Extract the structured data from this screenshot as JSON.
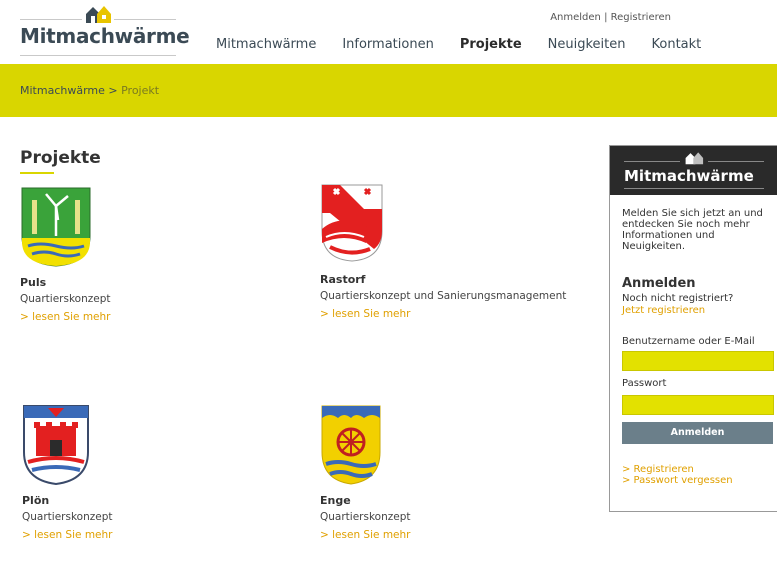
{
  "header": {
    "logo_text": "Mitmachwärme",
    "auth": {
      "login": "Anmelden",
      "separator": "|",
      "register": "Registrieren"
    },
    "nav": [
      {
        "label": "Mitmachwärme",
        "active": false
      },
      {
        "label": "Informationen",
        "active": false
      },
      {
        "label": "Projekte",
        "active": true
      },
      {
        "label": "Neuigkeiten",
        "active": false
      },
      {
        "label": "Kontakt",
        "active": false
      }
    ]
  },
  "breadcrumb": {
    "root": "Mitmachwärme",
    "separator": ">",
    "current": "Projekt"
  },
  "main": {
    "title": "Projekte",
    "projects": [
      {
        "name": "Puls",
        "type": "Quartierskonzept",
        "more": "> lesen Sie mehr",
        "crest": "puls-crest-icon"
      },
      {
        "name": "Rastorf",
        "type": "Quartierskonzept und Sanierungsmanagement",
        "more": "> lesen Sie mehr",
        "crest": "rastorf-crest-icon"
      },
      {
        "name": "Plön",
        "type": "Quartierskonzept",
        "more": "> lesen Sie mehr",
        "crest": "ploen-crest-icon"
      },
      {
        "name": "Enge",
        "type": "Quartierskonzept",
        "more": "> lesen Sie mehr",
        "crest": "enge-crest-icon"
      }
    ]
  },
  "sidebar": {
    "logo_text": "Mitmachwärme",
    "intro": "Melden Sie sich jetzt an und entdecken Sie noch mehr Informationen und Neuigkeiten.",
    "heading": "Anmelden",
    "not_registered": "Noch nicht registriert?",
    "register_now": "Jetzt registrieren",
    "username_label": "Benutzername oder E-Mail",
    "username_value": "",
    "password_label": "Passwort",
    "password_value": "",
    "submit": "Anmelden",
    "links": [
      "> Registrieren",
      "> Passwort vergessen"
    ]
  },
  "colors": {
    "accent_yellow": "#d9d600",
    "link_orange": "#e0a000",
    "text_dark": "#3b4a55",
    "button_gray": "#6b7f8a",
    "sidebar_head": "#2a2a2a"
  }
}
